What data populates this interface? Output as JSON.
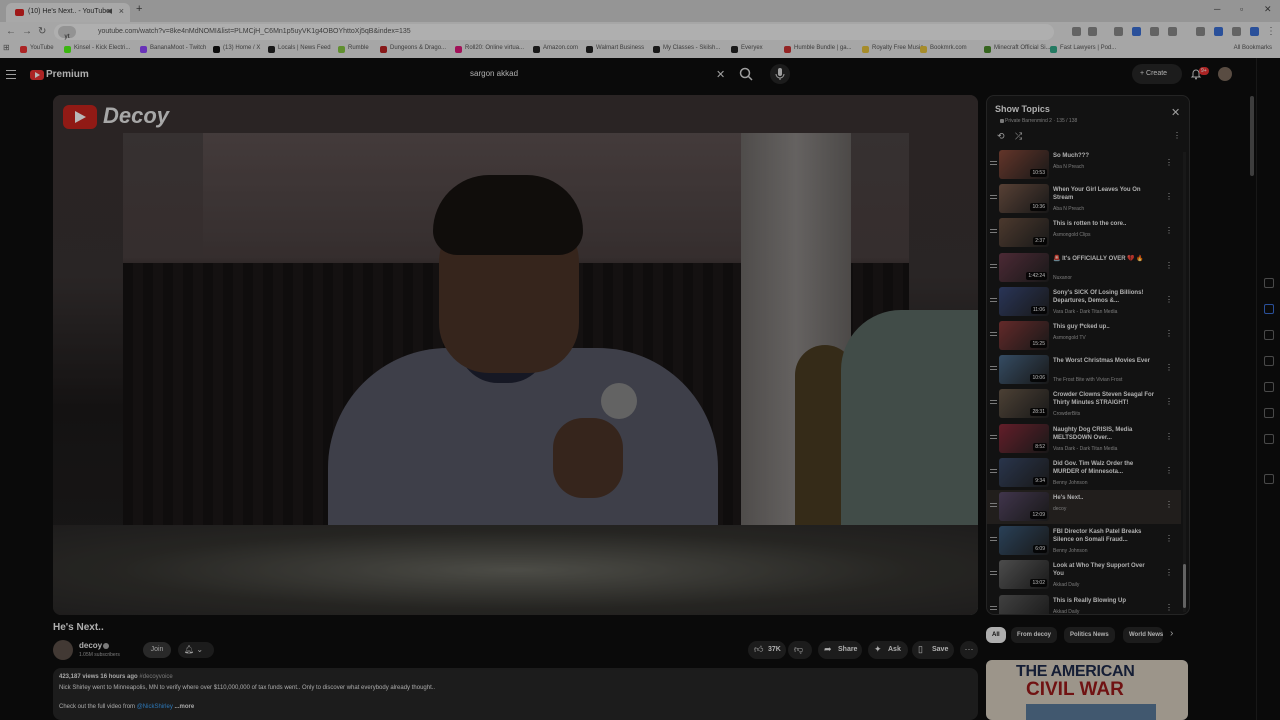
{
  "browser": {
    "tab_title": "(10) He's Next.. - YouTube",
    "new_tab": "+",
    "url_chip": "yt",
    "url": "youtube.com/watch?v=8ke4nMdNOMI&list=PLMCjH_C6Mn1p5uyVK1g4OBOYhttoXj5qB&index=135",
    "bookmarks": [
      {
        "label": "YouTube",
        "color": "#e33"
      },
      {
        "label": "Kinsel - Kick Electri...",
        "color": "#53fc18"
      },
      {
        "label": "BananaMoot - Twitch",
        "color": "#9146ff"
      },
      {
        "label": "(13) Home / X",
        "color": "#111"
      },
      {
        "label": "Locals | News Feed",
        "color": "#222"
      },
      {
        "label": "Rumble",
        "color": "#85c742"
      },
      {
        "label": "Dungeons & Drago...",
        "color": "#b22"
      },
      {
        "label": "Roll20: Online virtua...",
        "color": "#e0187b"
      },
      {
        "label": "Amazon.com",
        "color": "#222"
      },
      {
        "label": "Walmart Business",
        "color": "#222"
      },
      {
        "label": "My Classes - Skilsh...",
        "color": "#222"
      },
      {
        "label": "Everyex",
        "color": "#222"
      },
      {
        "label": "Humble Bundle | ga...",
        "color": "#c33"
      },
      {
        "label": "Royalty Free Music",
        "color": "#e7c23b"
      },
      {
        "label": "Bookmrk.com",
        "color": "#e7c23b"
      },
      {
        "label": "Minecraft Official Si...",
        "color": "#4b8c2b"
      },
      {
        "label": "Fast Lawyers | Pod...",
        "color": "#3a8"
      }
    ],
    "all_bookmarks": "All Bookmarks"
  },
  "header": {
    "logo_text": "Premium",
    "search_value": "sargon akkad",
    "create_label": "Create",
    "notif_count": "9+"
  },
  "video": {
    "overlay_logo": "Decoy",
    "title": "He's Next..",
    "channel": "decoy",
    "subscribers": "1.05M subscribers",
    "join_label": "Join",
    "likes": "37K",
    "share_label": "Share",
    "ask_label": "Ask",
    "save_label": "Save",
    "views_line": "423,187 views  16 hours ago",
    "hashtag": "#decoyvoice",
    "desc_line1": "Nick Shirley went to Minneapolis, MN to verify where over $110,000,000 of tax funds went.. Only to discover what everybody already thought..",
    "desc_line2_prefix": "Check out the full video from",
    "desc_link": "@NickShirley",
    "desc_more": "...more"
  },
  "playlist": {
    "title": "Show Topics",
    "subtitle": "Private  Barrenmind 2 · 135 / 138",
    "items": [
      {
        "title": "So Much???",
        "channel": "Aba N Preach",
        "duration": "10:53",
        "color": "#8a4a3a"
      },
      {
        "title": "When Your Girl Leaves You On Stream",
        "channel": "Aba N Preach",
        "duration": "10:36",
        "color": "#7a5a4a"
      },
      {
        "title": "This is rotten to the core..",
        "channel": "Asmongold Clips",
        "duration": "2:37",
        "color": "#6a5040"
      },
      {
        "title": "🚨 It's OFFICIALLY OVER 💔 🔥",
        "channel": "Nuxanor",
        "duration": "1:42:24",
        "color": "#6a3a4a"
      },
      {
        "title": "Sony's SICK Of Losing Billions! Departures, Demos &...",
        "channel": "Vara Dark - Dark Titan Media",
        "duration": "11:06",
        "color": "#3a4a7a"
      },
      {
        "title": "This guy f*cked up..",
        "channel": "Asmongold TV",
        "duration": "15:25",
        "color": "#8a3a3a"
      },
      {
        "title": "The Worst Christmas Movies Ever",
        "channel": "The Frost Bite with Vivian Frost",
        "duration": "10:06",
        "color": "#4a6a8a"
      },
      {
        "title": "Crowder Clowns Steven Seagal For Thirty Minutes STRAIGHT!",
        "channel": "CrowderBits",
        "duration": "28:31",
        "color": "#6a5a4a"
      },
      {
        "title": "Naughty Dog CRISIS, Media MELTSDOWN Over...",
        "channel": "Vara Dark - Dark Titan Media",
        "duration": "8:52",
        "color": "#8a2a3a"
      },
      {
        "title": "Did Gov. Tim Walz Order the MURDER of Minnesota...",
        "channel": "Benny Johnson",
        "duration": "9:34",
        "color": "#3a4a6a"
      },
      {
        "title": "He's Next..",
        "channel": "decoy",
        "duration": "12:09",
        "color": "#5a4a6a",
        "current": true
      },
      {
        "title": "FBI Director Kash Patel Breaks Silence on Somali Fraud...",
        "channel": "Benny Johnson",
        "duration": "6:09",
        "color": "#3a5a7a"
      },
      {
        "title": "Look at Who They Support Over You",
        "channel": "Akkad Daily",
        "duration": "13:02",
        "color": "#6a6a6a"
      },
      {
        "title": "This is Really Blowing Up",
        "channel": "Akkad Daily",
        "duration": "13:30",
        "color": "#5a5a5a"
      }
    ]
  },
  "chips": [
    "All",
    "From decoy",
    "Politics News",
    "World News"
  ],
  "recommended": {
    "line1": "THE AMERICAN",
    "line2": "CIVIL WAR"
  }
}
